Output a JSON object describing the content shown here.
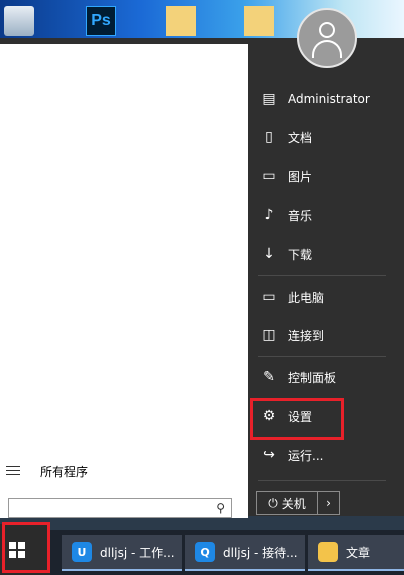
{
  "desktop": {
    "icons": [
      {
        "name": "recycle-bin"
      },
      {
        "name": "photoshop",
        "text": "Ps"
      },
      {
        "name": "folder"
      },
      {
        "name": "folder"
      }
    ]
  },
  "start_menu": {
    "all_programs": "所有程序",
    "search": {
      "value": "",
      "placeholder": ""
    },
    "user": "Administrator",
    "items": [
      {
        "label": "文档",
        "icon": "document-icon"
      },
      {
        "label": "图片",
        "icon": "pictures-icon"
      },
      {
        "label": "音乐",
        "icon": "music-icon"
      },
      {
        "label": "下载",
        "icon": "download-icon"
      },
      {
        "label": "此电脑",
        "icon": "computer-icon"
      },
      {
        "label": "连接到",
        "icon": "connect-icon"
      },
      {
        "label": "控制面板",
        "icon": "control-panel-icon"
      },
      {
        "label": "设置",
        "icon": "settings-icon"
      },
      {
        "label": "运行...",
        "icon": "run-icon"
      }
    ],
    "shutdown_label": "关机"
  },
  "taskbar": {
    "tasks": [
      {
        "label": "dlljsj - 工作...",
        "icon_text": "U",
        "color": "#1e88e5"
      },
      {
        "label": "dlljsj - 接待...",
        "icon_text": "Q",
        "color": "#1e88e5"
      },
      {
        "label": "文章",
        "icon_text": "",
        "color": "#f3c34a"
      }
    ]
  },
  "colors": {
    "highlight": "#e8212a",
    "menu_bg": "#2f2f2f",
    "taskbar_bg": "#1c232d"
  }
}
